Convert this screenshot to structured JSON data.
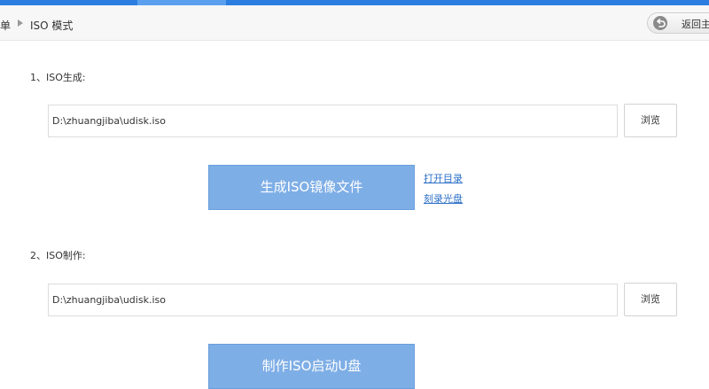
{
  "breadcrumb": {
    "parent": "单",
    "current": "ISO 模式"
  },
  "header": {
    "back_label": "返回主"
  },
  "sections": [
    {
      "label": "1、ISO生成:",
      "path_value": "D:\\zhuangjiba\\udisk.iso",
      "browse_label": "浏览",
      "action_label": "生成ISO镜像文件",
      "links": [
        "打开目录",
        "刻录光盘"
      ]
    },
    {
      "label": "2、ISO制作:",
      "path_value": "D:\\zhuangjiba\\udisk.iso",
      "browse_label": "浏览",
      "action_label": "制作ISO启动U盘"
    }
  ],
  "colors": {
    "accent": "#2b7de0",
    "primary_button": "#7eaee6",
    "link": "#2b6fc8"
  }
}
